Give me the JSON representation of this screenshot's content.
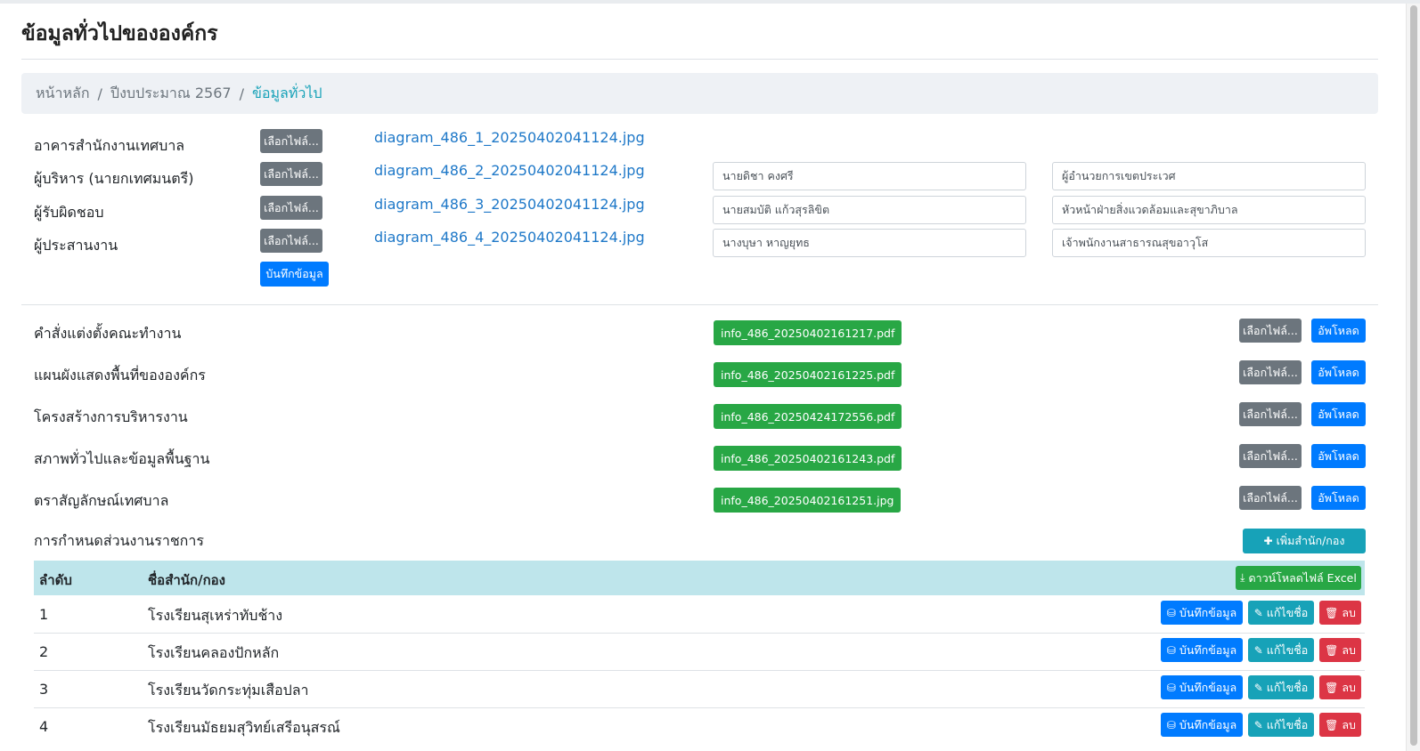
{
  "page": {
    "title": "ข้อมูลทั่วไปขององค์กร"
  },
  "breadcrumb": [
    "หน้าหลัก",
    "ปีงบประมาณ 2567",
    "ข้อมูลทั่วไป"
  ],
  "choose_file_label": "เลือกไฟล์...",
  "upload_label": "อัพโหลด",
  "save_label": "บันทึกข้อมูล",
  "edit_label": "แก้ไขชื่อ",
  "delete_label": "ลบ",
  "personnel": [
    {
      "label": "อาคารสำนักงานเทศบาล",
      "file": "diagram_486_1_20250402041124.jpg",
      "name": "",
      "position": ""
    },
    {
      "label": "ผู้บริหาร (นายกเทศมนตรี)",
      "file": "diagram_486_2_20250402041124.jpg",
      "name": "นายดิชา คงศรี",
      "position": "ผู้อำนวยการเขตประเวศ"
    },
    {
      "label": "ผู้รับผิดชอบ",
      "file": "diagram_486_3_20250402041124.jpg",
      "name": "นายสมบัติ แก้วสุรลิขิต",
      "position": "หัวหน้าฝ่ายสิ่งแวดล้อมและสุขาภิบาล"
    },
    {
      "label": "ผู้ประสานงาน",
      "file": "diagram_486_4_20250402041124.jpg",
      "name": "นางบุษา หาญยุทธ",
      "position": "เจ้าพนักงานสาธารณสุขอาวุโส"
    }
  ],
  "documents": [
    {
      "label": "คำสั่งแต่งตั้งคณะทำงาน",
      "file": "info_486_20250402161217.pdf"
    },
    {
      "label": "แผนผังแสดงพื้นที่ขององค์กร",
      "file": "info_486_20250402161225.pdf"
    },
    {
      "label": "โครงสร้างการบริหารงาน",
      "file": "info_486_20250424172556.pdf"
    },
    {
      "label": "สภาพทั่วไปและข้อมูลพื้นฐาน",
      "file": "info_486_20250402161243.pdf"
    },
    {
      "label": "ตราสัญลักษณ์เทศบาล",
      "file": "info_486_20250402161251.jpg"
    }
  ],
  "divisions": {
    "title": "การกำหนดส่วนงานราชการ",
    "add_label": "เพิ่มสำนัก/กอง",
    "download_label": "ดาวน์โหลดไฟล์ Excel",
    "columns": [
      "ลำดับ",
      "ชื่อสำนัก/กอง"
    ],
    "rows": [
      {
        "no": "1",
        "name": "โรงเรียนสุเหร่าทับช้าง"
      },
      {
        "no": "2",
        "name": "โรงเรียนคลองปักหลัก"
      },
      {
        "no": "3",
        "name": "โรงเรียนวัดกระทุ่มเสือปลา"
      },
      {
        "no": "4",
        "name": "โรงเรียนมัธยมสุวิทย์เสรีอนุสรณ์"
      }
    ]
  },
  "icons": {
    "plus": "plus-icon",
    "download": "download-icon",
    "database": "database-icon",
    "edit": "edit-icon",
    "trash": "trash-icon"
  }
}
